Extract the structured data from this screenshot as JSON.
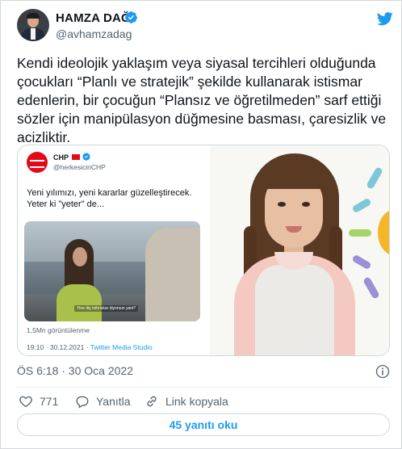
{
  "author": {
    "name": "HAMZA DAĞ",
    "handle": "@avhamzadag"
  },
  "tweet": {
    "text": "Kendi ideolojik yaklaşım veya siyasal tercihleri olduğunda çocukları “Planlı ve stratejik” şekilde kullanarak istismar edenlerin, bir çocuğun “Plansız ve öğretilmeden” sarf ettiği sözler için  manipülasyon düğmesine basması, çaresizlik ve acizliktir.",
    "timestamp": "ÖS 6:18 · 30 Oca 2022"
  },
  "embedded_tweet": {
    "name": "CHP",
    "handle": "@herkesicinCHP",
    "text": "Yeni yılımızı, yeni kararlar güzelleştirecek. Yeter ki \"yeter\" de...",
    "video_caption": "Yine diş mihriskar diyorsun yani?",
    "views": "1,5Mn görüntülenme",
    "time": "19:10 · 30.12.2021 · ",
    "via": "Twitter Media Studio"
  },
  "actions": {
    "like_count": "771",
    "reply_label": "Yanıtla",
    "copy_link_label": "Link kopyala"
  },
  "replies_button": "45 yanıtı oku",
  "colors": {
    "accent": "#1d9bf0",
    "chp_red": "#e30a17",
    "secondary_text": "#536471"
  }
}
